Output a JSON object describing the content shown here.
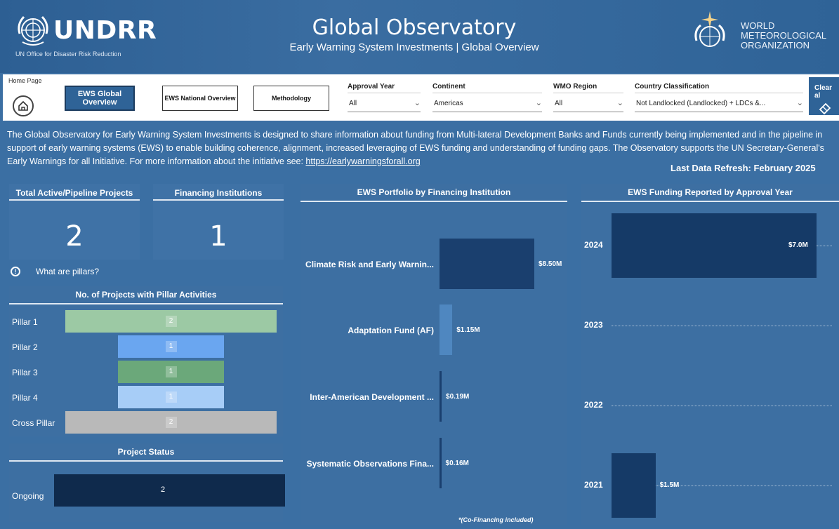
{
  "header": {
    "org_name": "UNDRR",
    "org_subtitle": "UN Office for Disaster Risk Reduction",
    "title": "Global Observatory",
    "subtitle": "Early Warning System Investments | Global Overview",
    "partner_line1": "WORLD",
    "partner_line2": "METEOROLOGICAL",
    "partner_line3": "ORGANIZATION"
  },
  "toolbar": {
    "home_label": "Home Page",
    "nav": [
      "EWS Global Overview",
      "EWS National Overview",
      "Methodology"
    ],
    "filters": [
      {
        "label": "Approval Year",
        "value": "All"
      },
      {
        "label": "Continent",
        "value": "Americas"
      },
      {
        "label": "WMO Region",
        "value": "All"
      },
      {
        "label": "Country Classification",
        "value": "Not Landlocked (Landlocked) + LDCs &..."
      }
    ],
    "clear_label": "Clear al"
  },
  "description": {
    "text": "The Global Observatory for Early Warning System Investments is designed to share information about funding from Multi-lateral Development Banks and Funds currently being implemented and in the pipeline in support of early warning systems (EWS) to enable building coherence, alignment, increased leveraging of EWS funding and understanding of funding gaps. The Observatory supports the UN Secretary-General's Early Warnings for all Initiative. For more information about the initiative see: ",
    "link": "https://earlywarningsforall.org",
    "refresh": "Last Data Refresh:  February 2025"
  },
  "kpis": [
    {
      "title": "Total Active/Pipeline Projects",
      "value": "2"
    },
    {
      "title": "Financing Institutions",
      "value": "1"
    }
  ],
  "pillars_question": "What are pillars?",
  "pillars": {
    "title": "No. of Projects with Pillar Activities",
    "rows": [
      {
        "label": "Pillar 1",
        "value": 2,
        "color": "#9cc9a4"
      },
      {
        "label": "Pillar 2",
        "value": 1,
        "color": "#6aa6f0"
      },
      {
        "label": "Pillar 3",
        "value": 1,
        "color": "#6ba87a"
      },
      {
        "label": "Pillar 4",
        "value": 1,
        "color": "#a7cdf7"
      },
      {
        "label": "Cross Pillar",
        "value": 2,
        "color": "#b9b9b9"
      }
    ]
  },
  "status": {
    "title": "Project Status",
    "label": "Ongoing",
    "value": "2"
  },
  "portfolio": {
    "title": "EWS Portfolio by Financing Institution",
    "footnote": "*(Co-Financing included)"
  },
  "funding": {
    "title": "EWS Funding Reported by Approval Year"
  },
  "chart_data": [
    {
      "type": "bar",
      "orientation": "horizontal",
      "title": "No. of Projects with Pillar Activities",
      "categories": [
        "Pillar 1",
        "Pillar 2",
        "Pillar 3",
        "Pillar 4",
        "Cross Pillar"
      ],
      "values": [
        2,
        1,
        1,
        1,
        2
      ]
    },
    {
      "type": "bar",
      "orientation": "horizontal",
      "title": "Project Status",
      "categories": [
        "Ongoing"
      ],
      "values": [
        2
      ]
    },
    {
      "type": "bar",
      "orientation": "horizontal",
      "title": "EWS Portfolio by Financing Institution",
      "categories": [
        "Climate Risk and Early Warnin...",
        "Adaptation Fund (AF)",
        "Inter-American Development ...",
        "Systematic Observations Fina..."
      ],
      "values": [
        8.5,
        1.15,
        0.19,
        0.16
      ],
      "labels": [
        "$8.50M",
        "$1.15M",
        "$0.19M",
        "$0.16M"
      ],
      "unit": "$M",
      "colors": [
        "#1a3f6e",
        "#4f87c0",
        "#1a3f6e",
        "#1a3f6e"
      ]
    },
    {
      "type": "bar",
      "orientation": "horizontal",
      "title": "EWS Funding Reported by Approval Year",
      "categories": [
        "2024",
        "2023",
        "2022",
        "2021"
      ],
      "values": [
        7.0,
        0,
        0,
        1.5
      ],
      "labels": [
        "$7.0M",
        "",
        "",
        "$1.5M"
      ],
      "unit": "$M"
    }
  ]
}
